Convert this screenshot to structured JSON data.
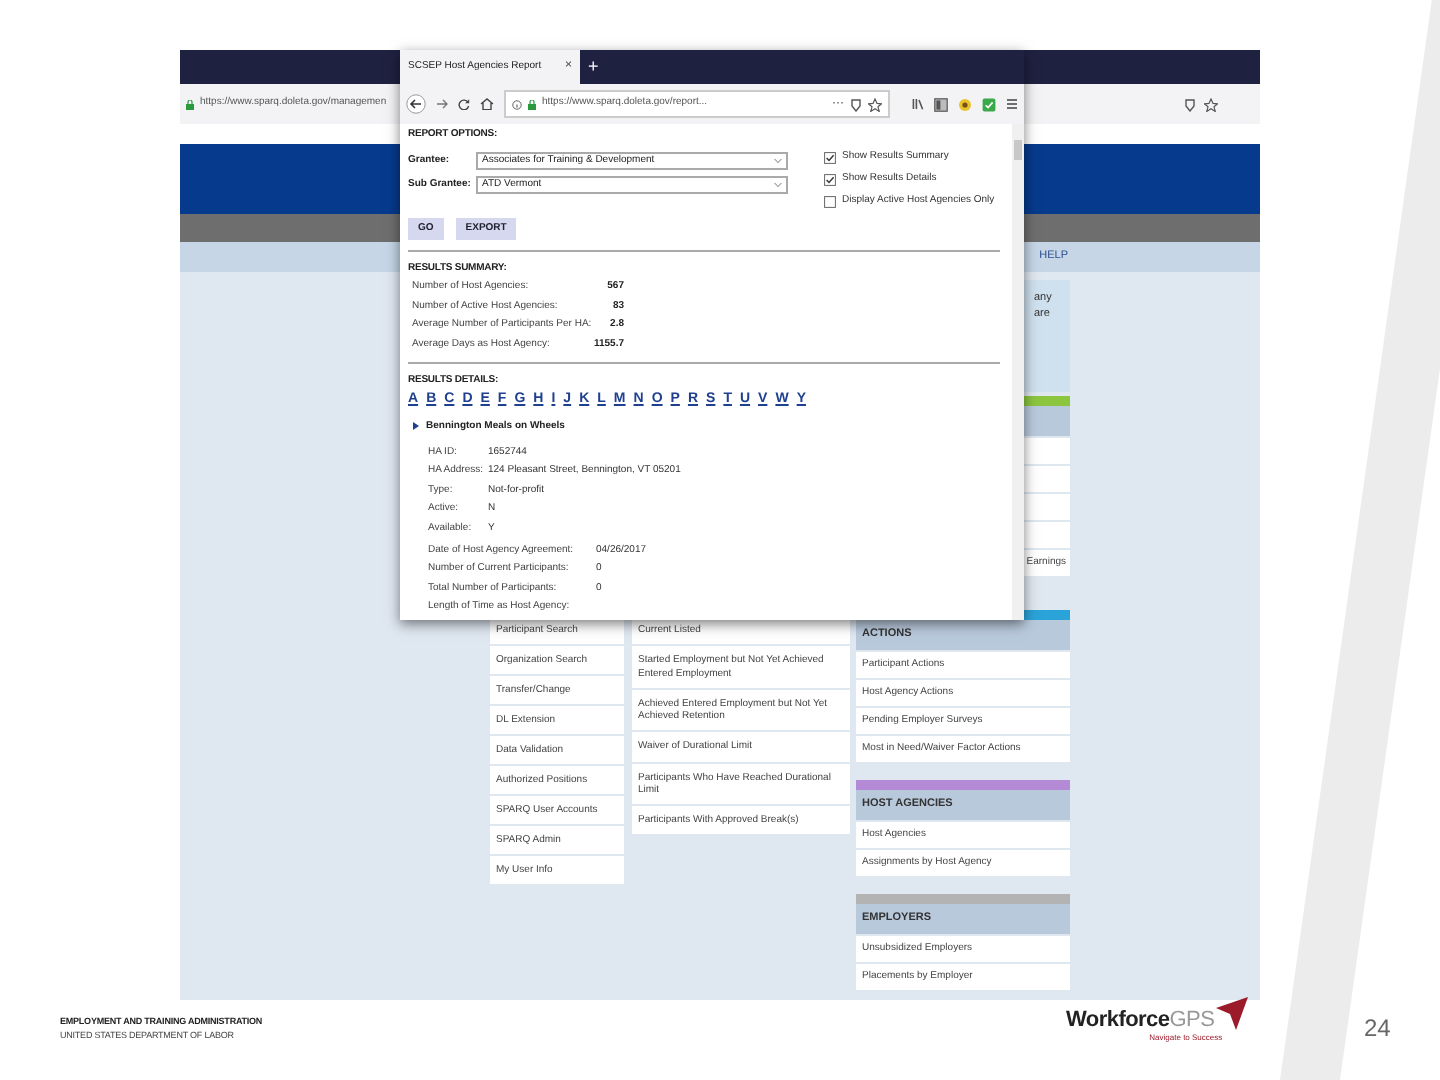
{
  "background_browser": {
    "url": "https://www.sparq.doleta.gov/managemen",
    "nav": {
      "help": "HELP"
    },
    "side_texts": [
      "any",
      "are"
    ],
    "side_rows": [
      "",
      "",
      "",
      "",
      "Earnings"
    ],
    "column_1": [
      "Participant Search",
      "Organization Search",
      "Transfer/Change",
      "DL Extension",
      "Data Validation",
      "Authorized Positions",
      "SPARQ User Accounts",
      "SPARQ Admin",
      "My User Info"
    ],
    "column_2": [
      "Current Listed",
      "Started Employment but Not Yet Achieved Entered Employment",
      "Achieved Entered Employment but Not Yet Achieved Retention",
      "Waiver of Durational Limit",
      "Participants Who Have Reached Durational Limit",
      "Participants With Approved Break(s)"
    ],
    "sections": [
      {
        "title": "ACTIONS",
        "color": "#2aa3d8",
        "items": [
          "Participant Actions",
          "Host Agency Actions",
          "Pending Employer Surveys",
          "Most in Need/Waiver Factor Actions"
        ]
      },
      {
        "title": "HOST AGENCIES",
        "color": "#b48ad6",
        "items": [
          "Host Agencies",
          "Assignments by Host Agency"
        ]
      },
      {
        "title": "EMPLOYERS",
        "color": "#b3b3b3",
        "items": [
          "Unsubsidized Employers",
          "Placements by Employer"
        ]
      }
    ]
  },
  "popup": {
    "tab": {
      "title": "SCSEP Host Agencies Report",
      "close": "×",
      "new": "+"
    },
    "url": "https://www.sparq.doleta.gov/report...",
    "more": "···",
    "report_options": {
      "heading": "REPORT OPTIONS:",
      "fields": [
        {
          "label": "Grantee:",
          "value": "Associates for Training & Development"
        },
        {
          "label": "Sub Grantee:",
          "value": "ATD Vermont"
        }
      ],
      "checkboxes": [
        {
          "label": "Show Results Summary",
          "checked": true
        },
        {
          "label": "Show Results Details",
          "checked": true
        },
        {
          "label": "Display Active Host Agencies Only",
          "checked": false
        }
      ],
      "buttons": [
        "GO",
        "EXPORT"
      ]
    },
    "results_summary": {
      "heading": "RESULTS SUMMARY:",
      "rows": [
        {
          "label": "Number of Host Agencies:",
          "value": "567"
        },
        {
          "label": "Number of Active Host Agencies:",
          "value": "83"
        },
        {
          "label": "Average Number of Participants Per HA:",
          "value": "2.8"
        },
        {
          "label": "Average Days as Host Agency:",
          "value": "1155.7"
        }
      ]
    },
    "results_details": {
      "heading": "RESULTS DETAILS:",
      "letters": [
        "A",
        "B",
        "C",
        "D",
        "E",
        "F",
        "G",
        "H",
        "I",
        "J",
        "K",
        "L",
        "M",
        "N",
        "O",
        "P",
        "R",
        "S",
        "T",
        "U",
        "V",
        "W",
        "Y"
      ],
      "agency": {
        "name": "Bennington Meals on Wheels",
        "expanded": true,
        "fields": [
          {
            "label": "HA ID:",
            "value": "1652744"
          },
          {
            "label": "HA Address:",
            "value": "124 Pleasant Street, Bennington, VT 05201"
          },
          {
            "label": "Type:",
            "value": "Not-for-profit"
          },
          {
            "label": "Active:",
            "value": "N"
          },
          {
            "label": "Available:",
            "value": "Y"
          }
        ],
        "facts": [
          {
            "label": "Date of Host Agency Agreement:",
            "value": "04/26/2017"
          },
          {
            "label": "Number of Current Participants:",
            "value": "0"
          },
          {
            "label": "Total Number of Participants:",
            "value": "0"
          },
          {
            "label": "Length of Time as Host Agency:"
          }
        ]
      }
    }
  },
  "footer": {
    "org": "EMPLOYMENT AND TRAINING ADMINISTRATION",
    "department": "UNITED STATES DEPARTMENT OF LABOR",
    "logo": "**Workforce**GPS",
    "tagline": "Navigate to Success",
    "page": "24"
  }
}
